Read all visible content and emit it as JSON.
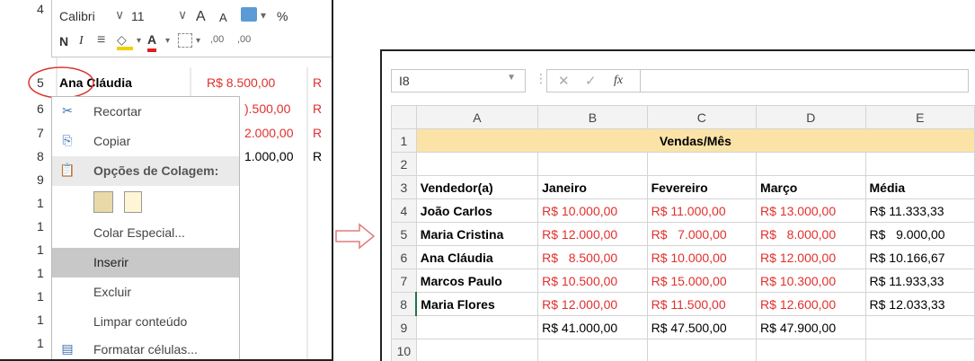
{
  "left": {
    "toolbar": {
      "font_name": "Calibri",
      "font_size": "11",
      "grow_font": "A",
      "shrink_font": "A",
      "percent": "%",
      "bold": "N",
      "italic": "I",
      "dec_inc": ",00",
      "dec_dec": ",00"
    },
    "rows": [
      {
        "num": "4",
        "name": "",
        "value": ""
      },
      {
        "num": "5",
        "name": "Ana Cláudia",
        "value": "R$    8.500,00",
        "next": "R"
      },
      {
        "num": "6",
        "name": "",
        "value": ").500,00",
        "next": "R"
      },
      {
        "num": "7",
        "name": "",
        "value": "2.000,00",
        "next": "R"
      },
      {
        "num": "8",
        "name": "",
        "value": "1.000,00",
        "next": "R"
      },
      {
        "num": "9",
        "name": "",
        "value": ""
      },
      {
        "num": "1",
        "name": "",
        "value": ""
      },
      {
        "num": "1",
        "name": "",
        "value": ""
      },
      {
        "num": "1",
        "name": "",
        "value": ""
      },
      {
        "num": "1",
        "name": "",
        "value": ""
      },
      {
        "num": "1",
        "name": "",
        "value": ""
      },
      {
        "num": "1",
        "name": "",
        "value": ""
      },
      {
        "num": "1",
        "name": "",
        "value": ""
      }
    ],
    "menu": {
      "cut": "Recortar",
      "copy": "Copiar",
      "paste_header": "Opções de Colagem:",
      "paste_special": "Colar Especial...",
      "insert": "Inserir",
      "delete": "Excluir",
      "clear": "Limpar conteúdo",
      "format": "Formatar células..."
    }
  },
  "right": {
    "name_box": "I8",
    "fx": "fx",
    "columns": [
      "A",
      "B",
      "C",
      "D",
      "E"
    ],
    "title": "Vendas/Mês",
    "header": [
      "Vendedor(a)",
      "Janeiro",
      "Fevereiro",
      "Março",
      "Média"
    ],
    "rows": [
      [
        "João Carlos",
        "R$ 10.000,00",
        "R$ 11.000,00",
        "R$ 13.000,00",
        "R$ 11.333,33"
      ],
      [
        "Maria Cristina",
        "R$ 12.000,00",
        "R$   7.000,00",
        "R$   8.000,00",
        "R$   9.000,00"
      ],
      [
        "Ana Cláudia",
        "R$   8.500,00",
        "R$ 10.000,00",
        "R$ 12.000,00",
        "R$ 10.166,67"
      ],
      [
        "Marcos Paulo",
        "R$ 10.500,00",
        "R$ 15.000,00",
        "R$ 10.300,00",
        "R$ 11.933,33"
      ],
      [
        "Maria Flores",
        "R$ 12.000,00",
        "R$ 11.500,00",
        "R$ 12.600,00",
        "R$ 12.033,33"
      ]
    ],
    "totals": [
      "",
      "R$ 41.000,00",
      "R$ 47.500,00",
      "R$ 47.900,00",
      ""
    ],
    "row_numbers": [
      "1",
      "2",
      "3",
      "4",
      "5",
      "6",
      "7",
      "8",
      "9",
      "10"
    ]
  },
  "colors": {
    "red_text": "#e0302c",
    "title_fill": "#fbe3a8",
    "highlight_circle": "#d9342b",
    "arrow": "#e07c7c"
  }
}
